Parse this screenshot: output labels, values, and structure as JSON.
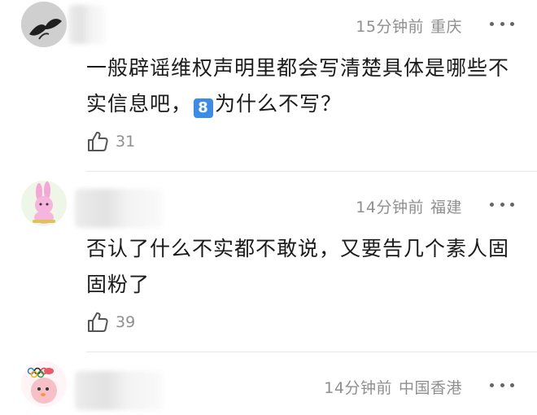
{
  "comments": [
    {
      "time": "15分钟前",
      "location": "重庆",
      "text_before": "一般辟谣维权声明里都会写清楚具体是哪些不实信息吧，",
      "badge": "8",
      "text_after": "为什么不写？",
      "likes": "31",
      "avatar": "butterfly-avatar"
    },
    {
      "time": "14分钟前",
      "location": "福建",
      "text": "否认了什么不实都不敢说，又要告几个素人固固粉了",
      "likes": "39",
      "avatar": "pink-bunny-avatar"
    },
    {
      "time": "14分钟前",
      "location": "中国香港",
      "avatar": "pink-bird-olympic-avatar"
    }
  ]
}
